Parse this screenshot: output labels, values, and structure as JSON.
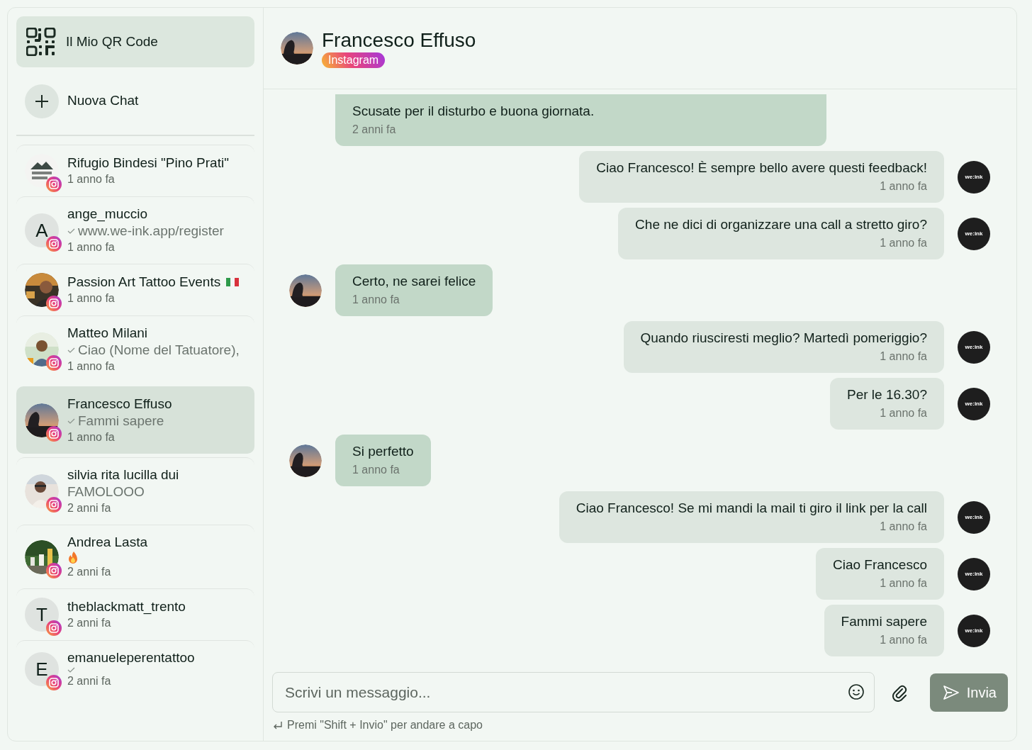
{
  "sidebar": {
    "qr_button": "Il Mio QR Code",
    "new_chat_button": "Nuova Chat",
    "contacts": [
      {
        "name": "Rifugio Bindesi \"Pino Prati\"",
        "flag": false,
        "read": false,
        "time": "1 anno fa",
        "selected": false
      },
      {
        "name": "ange_muccio",
        "avatar": {
          "kind": "initial",
          "letter": "A"
        },
        "flag": false,
        "preview": "www.we-ink.app/register",
        "read": true,
        "time": "1 anno fa",
        "selected": false
      },
      {
        "name": "Passion Art Tattoo Events",
        "flag": true,
        "read": false,
        "time": "1 anno fa",
        "selected": false
      },
      {
        "name": "Matteo Milani",
        "flag": false,
        "preview": "Ciao (Nome del Tatuatore),",
        "read": true,
        "time": "1 anno fa",
        "selected": false
      },
      {
        "name": "Francesco Effuso",
        "flag": false,
        "preview": "Fammi sapere",
        "read": true,
        "time": "1 anno fa",
        "selected": true
      },
      {
        "name": "silvia rita lucilla dui",
        "flag": false,
        "preview": "FAMOLOOO",
        "read": false,
        "time": "2 anni fa",
        "selected": false
      },
      {
        "name": "Andrea Lasta",
        "flag": false,
        "flame": true,
        "read": false,
        "time": "2 anni fa",
        "selected": false
      },
      {
        "name": "theblackmatt_trento",
        "avatar": {
          "kind": "initial",
          "letter": "T"
        },
        "flag": false,
        "read": false,
        "time": "2 anni fa",
        "selected": false
      },
      {
        "name": "emanueleperentattoo",
        "avatar": {
          "kind": "initial",
          "letter": "E"
        },
        "flag": false,
        "read": true,
        "time": "2 anni fa",
        "selected": false
      }
    ]
  },
  "chat": {
    "title": "Francesco Effuso",
    "platform": "Instagram",
    "messages": [
      {
        "kind": "incoming",
        "cut_off": true,
        "avatar": false,
        "text": "Scusate per il disturbo e buona giornata.",
        "time": "2 anni fa"
      },
      {
        "kind": "outgoing",
        "text": "Ciao Francesco! È sempre bello avere questi feedback!",
        "time": "1 anno fa",
        "avatar_text": "we:ink"
      },
      {
        "kind": "outgoing",
        "text": "Che ne dici di organizzare una call a stretto giro?",
        "time": "1 anno fa",
        "avatar_text": "we:ink"
      },
      {
        "kind": "incoming",
        "cut_off": false,
        "avatar": true,
        "text": "Certo, ne sarei felice",
        "time": "1 anno fa"
      },
      {
        "kind": "outgoing",
        "text": "Quando riusciresti meglio? Martedì pomeriggio?",
        "time": "1 anno fa",
        "avatar_text": "we:ink"
      },
      {
        "kind": "outgoing",
        "text": "Per le 16.30?",
        "time": "1 anno fa",
        "avatar_text": "we:ink"
      },
      {
        "kind": "incoming",
        "cut_off": false,
        "avatar": true,
        "text": "Si perfetto",
        "time": "1 anno fa"
      },
      {
        "kind": "outgoing",
        "text": "Ciao Francesco! Se mi mandi la mail ti giro il link per la call",
        "time": "1 anno fa",
        "avatar_text": "we:ink"
      },
      {
        "kind": "outgoing",
        "text": "Ciao Francesco",
        "time": "1 anno fa",
        "avatar_text": "we:ink"
      },
      {
        "kind": "outgoing",
        "text": "Fammi sapere",
        "time": "1 anno fa",
        "avatar_text": "we:ink"
      }
    ],
    "composer": {
      "placeholder": "Scrivi un messaggio...",
      "send_button": "Invia",
      "hint": "Premi \"Shift + Invio\" per andare a capo"
    }
  }
}
